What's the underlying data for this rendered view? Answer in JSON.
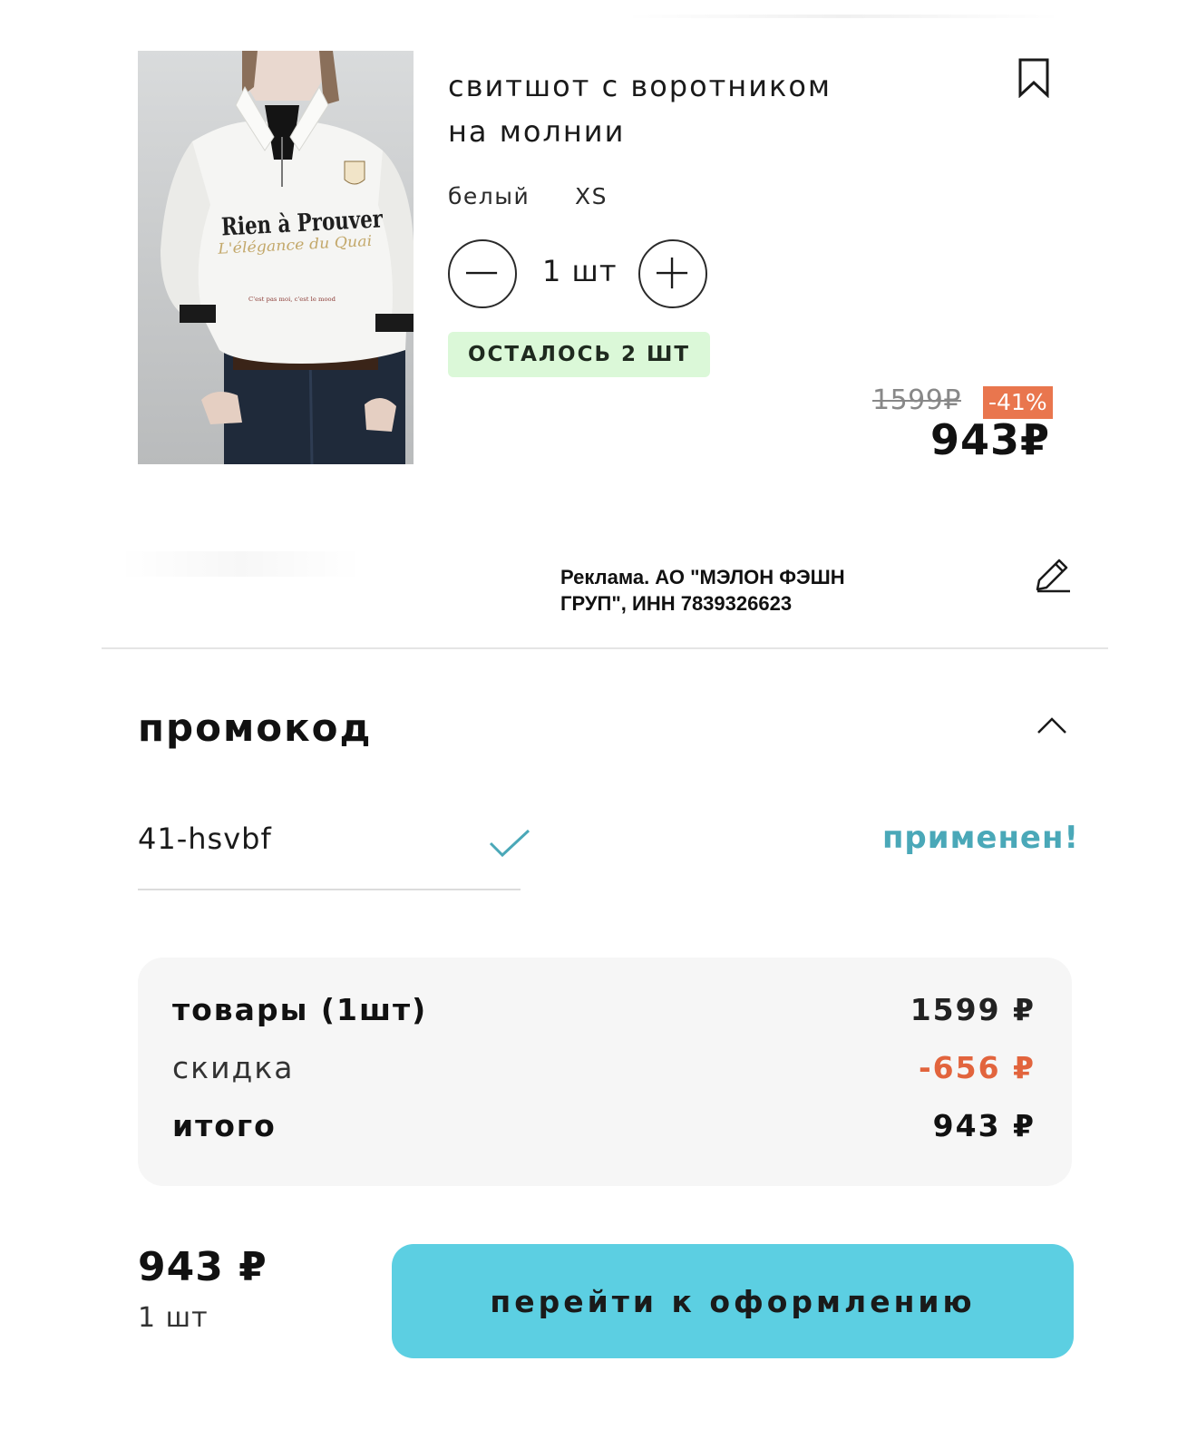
{
  "product": {
    "title_line1": "свитшот с воротником",
    "title_line2": "на молнии",
    "color": "белый",
    "size": "XS",
    "quantity": "1 шт",
    "stock_note": "ОСТАЛОСЬ 2 ШТ",
    "old_price": "1599₽",
    "discount": "-41%",
    "price": "943₽",
    "image_print_title": "Rien à Prouver",
    "image_print_script": "L'élégance du Quai",
    "image_print_small": "C'est pas moi, c'est le mood"
  },
  "ad_notice": {
    "line1": "Реклама. АО \"МЭЛОН ФЭШН",
    "line2": "ГРУП\", ИНН 7839326623"
  },
  "promo": {
    "heading": "промокод",
    "code": "41-hsvbf",
    "status": "применен!"
  },
  "summary": {
    "items_label": "товары (1шт)",
    "items_value": "1599 ₽",
    "discount_label": "скидка",
    "discount_value": "-656 ₽",
    "total_label": "итого",
    "total_value": "943 ₽"
  },
  "footer": {
    "total": "943 ₽",
    "quantity": "1 шт",
    "checkout_label": "перейти к оформлению"
  },
  "colors": {
    "accent_button": "#5ccfe2",
    "promo_applied": "#4aa8b8",
    "discount_badge": "#e9764e",
    "discount_text": "#e2643d",
    "stock_badge_bg": "#dbf8d8"
  },
  "icons": [
    "bookmark-icon",
    "minus-icon",
    "plus-icon",
    "edit-icon",
    "chevron-up-icon",
    "check-icon"
  ]
}
